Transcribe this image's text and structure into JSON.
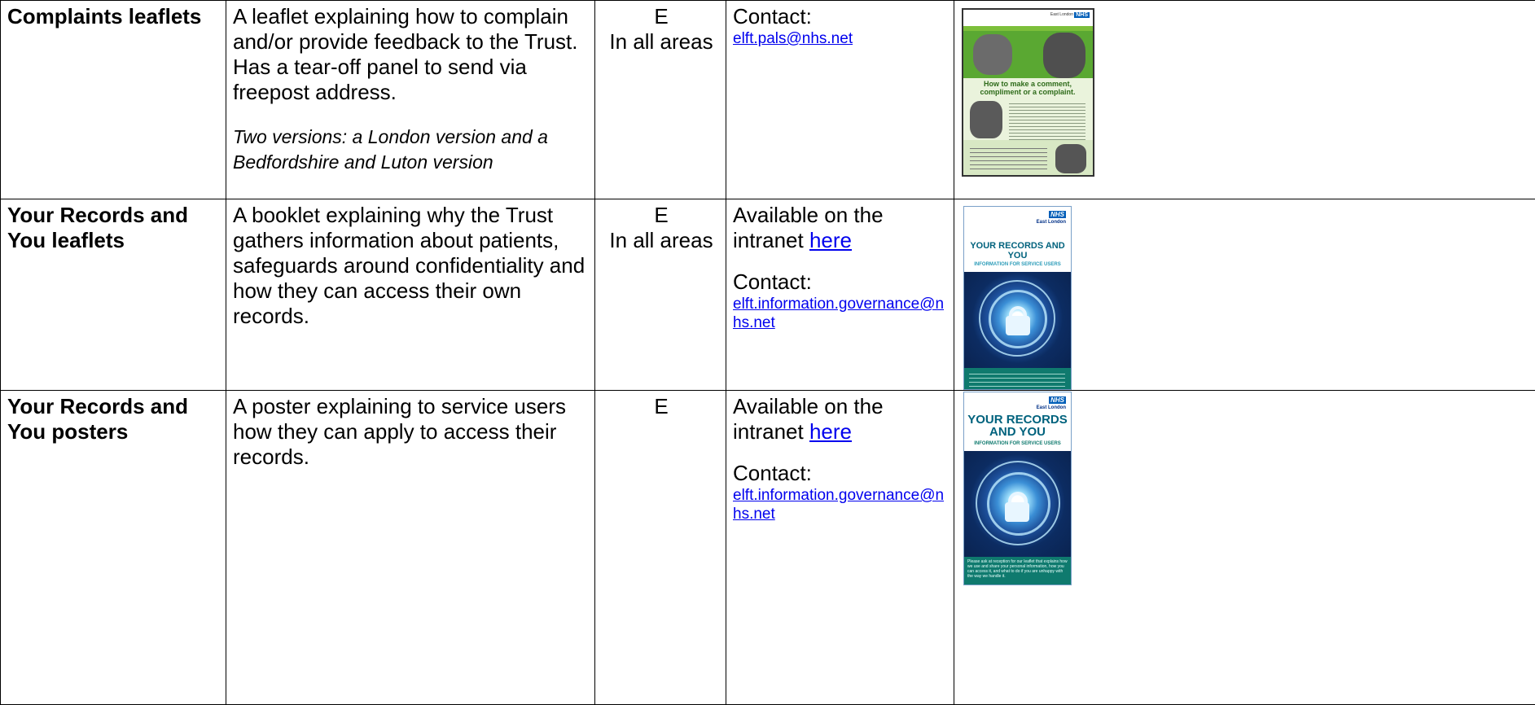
{
  "rows": [
    {
      "name": "Complaints leaflets",
      "description": "A leaflet explaining how to complain and/or provide feedback to the Trust. Has a tear-off panel to send via freepost address.",
      "note": "Two versions: a London version and a Bedfordshire and Luton version",
      "category_code": "E",
      "category_area": "In all areas",
      "contact_label": "Contact:",
      "contact_email": "elft.pals@nhs.net",
      "thumbnail": {
        "nhs_logo": "NHS",
        "org": "East London",
        "heading": "How to make a comment, compliment or a complaint."
      }
    },
    {
      "name": "Your Records and You leaflets",
      "description": "A booklet explaining why the Trust gathers information about patients, safeguards around confidentiality and how they can access their own records.",
      "category_code": "E",
      "category_area": "In all areas",
      "availability_text": "Available on the intranet",
      "availability_link": "here",
      "contact_label": "Contact:",
      "contact_email": "elft.information.governance@nhs.net",
      "thumbnail": {
        "nhs_logo": "NHS",
        "org": "East London",
        "title": "YOUR RECORDS AND YOU",
        "subtitle": "INFORMATION FOR SERVICE USERS"
      }
    },
    {
      "name": "Your Records and You posters",
      "description": "A poster explaining to service users how they can apply to access their records.",
      "category_code": "E",
      "availability_text": "Available on the intranet",
      "availability_link": "here",
      "contact_label": "Contact:",
      "contact_email": "elft.information.governance@nhs.net",
      "thumbnail": {
        "nhs_logo": "NHS",
        "org": "East London",
        "title": "YOUR RECORDS AND YOU",
        "subtitle": "INFORMATION FOR SERVICE USERS",
        "footer": "Please ask at reception for our leaflet that explains how we use and share your personal information, how you can access it, and what to do if you are unhappy with the way we handle it."
      }
    }
  ]
}
